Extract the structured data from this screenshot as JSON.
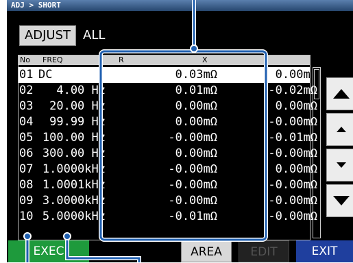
{
  "breadcrumb": "ADJ > SHORT",
  "adjust_button": "ADJUST",
  "mode_label": "ALL",
  "headers": {
    "no": "No",
    "freq": "FREQ",
    "r": "R",
    "x": "X"
  },
  "rows": [
    {
      "no": "01",
      "freq": "DC",
      "r": "0.03mΩ",
      "x": "0.00mΩ"
    },
    {
      "no": "02",
      "freq": "4.00 Hz",
      "r": "0.01mΩ",
      "x": "-0.02mΩ"
    },
    {
      "no": "03",
      "freq": "20.00 Hz",
      "r": "0.00mΩ",
      "x": "0.00mΩ"
    },
    {
      "no": "04",
      "freq": "99.99 Hz",
      "r": "0.00mΩ",
      "x": "-0.00mΩ"
    },
    {
      "no": "05",
      "freq": "100.00 Hz",
      "r": "-0.00mΩ",
      "x": "-0.01mΩ"
    },
    {
      "no": "06",
      "freq": "300.00 Hz",
      "r": "0.00mΩ",
      "x": "-0.00mΩ"
    },
    {
      "no": "07",
      "freq": "1.0000kHz",
      "r": "-0.00mΩ",
      "x": "0.00mΩ"
    },
    {
      "no": "08",
      "freq": "1.0001kHz",
      "r": "-0.00mΩ",
      "x": "-0.00mΩ"
    },
    {
      "no": "09",
      "freq": "3.0000kHz",
      "r": "-0.00mΩ",
      "x": "-0.00mΩ"
    },
    {
      "no": "10",
      "freq": "5.0000kHz",
      "r": "-0.01mΩ",
      "x": "-0.00mΩ"
    }
  ],
  "bottom": {
    "exec": "EXEC",
    "area": "AREA",
    "edit": "EDIT",
    "exit": "EXIT"
  },
  "colors": {
    "exec": "#1e9a3c",
    "exit": "#1f3f9e",
    "callout": "#1f5fb0"
  }
}
